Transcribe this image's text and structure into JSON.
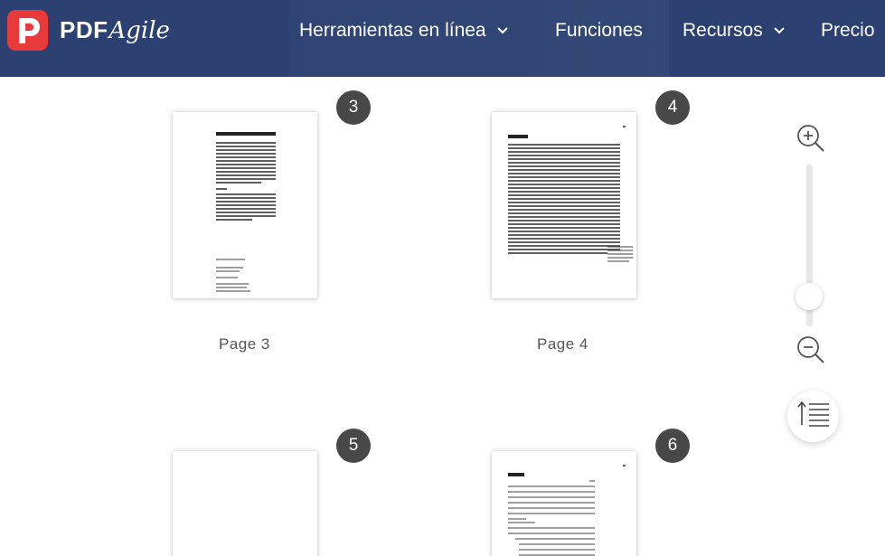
{
  "brand": {
    "name_pdf": "PDF",
    "name_agile": "Agile"
  },
  "nav": {
    "tools": "Herramientas en línea",
    "functions": "Funciones",
    "resources": "Recursos",
    "price": "Precio"
  },
  "pages": [
    {
      "number": "3",
      "label": "Page 3"
    },
    {
      "number": "4",
      "label": "Page 4"
    },
    {
      "number": "5"
    },
    {
      "number": "6"
    }
  ],
  "icons": {
    "logo": "pdfagile-logo-icon",
    "zoom_in": "zoom-in-icon",
    "zoom_out": "zoom-out-icon",
    "toc": "table-of-contents-icon"
  },
  "colors": {
    "header": "#2c4171",
    "logo": "#e83a3a",
    "badge": "#484848"
  }
}
